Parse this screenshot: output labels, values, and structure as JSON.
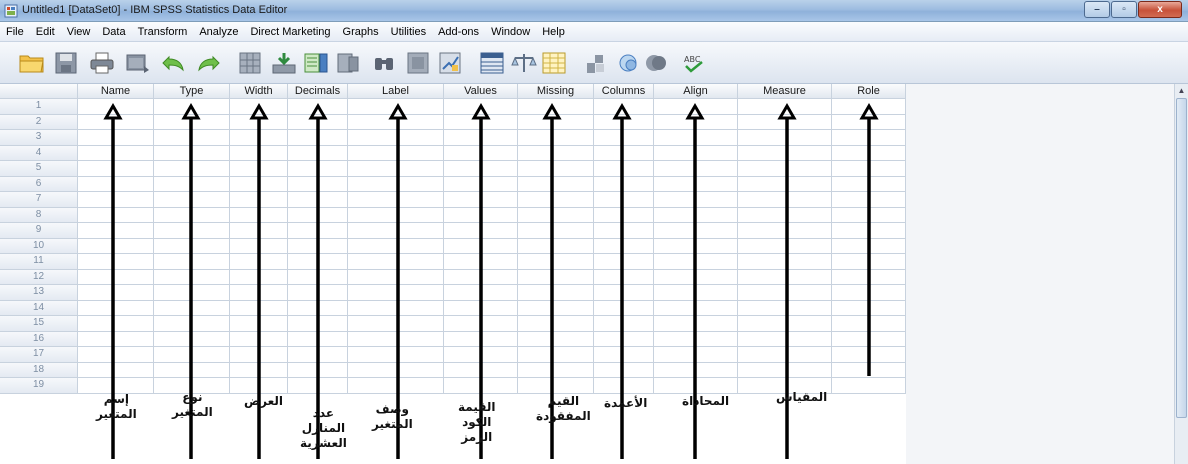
{
  "window": {
    "title": "Untitled1 [DataSet0] - IBM SPSS Statistics Data Editor",
    "buttons": {
      "minimize": "–",
      "maximize": "▫",
      "close": "x"
    }
  },
  "menu": [
    "File",
    "Edit",
    "View",
    "Data",
    "Transform",
    "Analyze",
    "Direct Marketing",
    "Graphs",
    "Utilities",
    "Add-ons",
    "Window",
    "Help"
  ],
  "toolbar": [
    "open-folder-icon",
    "save-icon",
    "print-icon",
    "dialog-recall-icon",
    "undo-icon",
    "redo-icon",
    "goto-case-icon",
    "goto-variable-icon",
    "variables-icon",
    "run-descriptives-icon",
    "find-icon",
    "insert-cases-icon",
    "insert-variable-icon",
    "split-file-icon",
    "weight-cases-icon",
    "select-cases-icon",
    "value-labels-icon",
    "use-variable-sets-icon",
    "show-all-variables-icon",
    "spell-check-icon"
  ],
  "columns": [
    "Name",
    "Type",
    "Width",
    "Decimals",
    "Label",
    "Values",
    "Missing",
    "Columns",
    "Align",
    "Measure",
    "Role"
  ],
  "rows": [
    "1",
    "2",
    "3",
    "4",
    "5",
    "6",
    "7",
    "8",
    "9",
    "10",
    "11",
    "12",
    "13",
    "14",
    "15",
    "16",
    "17",
    "18",
    "19"
  ],
  "annotations": [
    {
      "text": "إسم\nالمتغير"
    },
    {
      "text": "نوع\nالمتغير"
    },
    {
      "text": "العرض"
    },
    {
      "text": "عدد\nالمنازل\nالعشرية"
    },
    {
      "text": "وصف\nالمتغير"
    },
    {
      "text": "القيمة\nالكود\nالرمز"
    },
    {
      "text": "القيم\nالمفقودة"
    },
    {
      "text": "الأعمدة"
    },
    {
      "text": "المحاذاة"
    },
    {
      "text": "المقياس"
    }
  ]
}
